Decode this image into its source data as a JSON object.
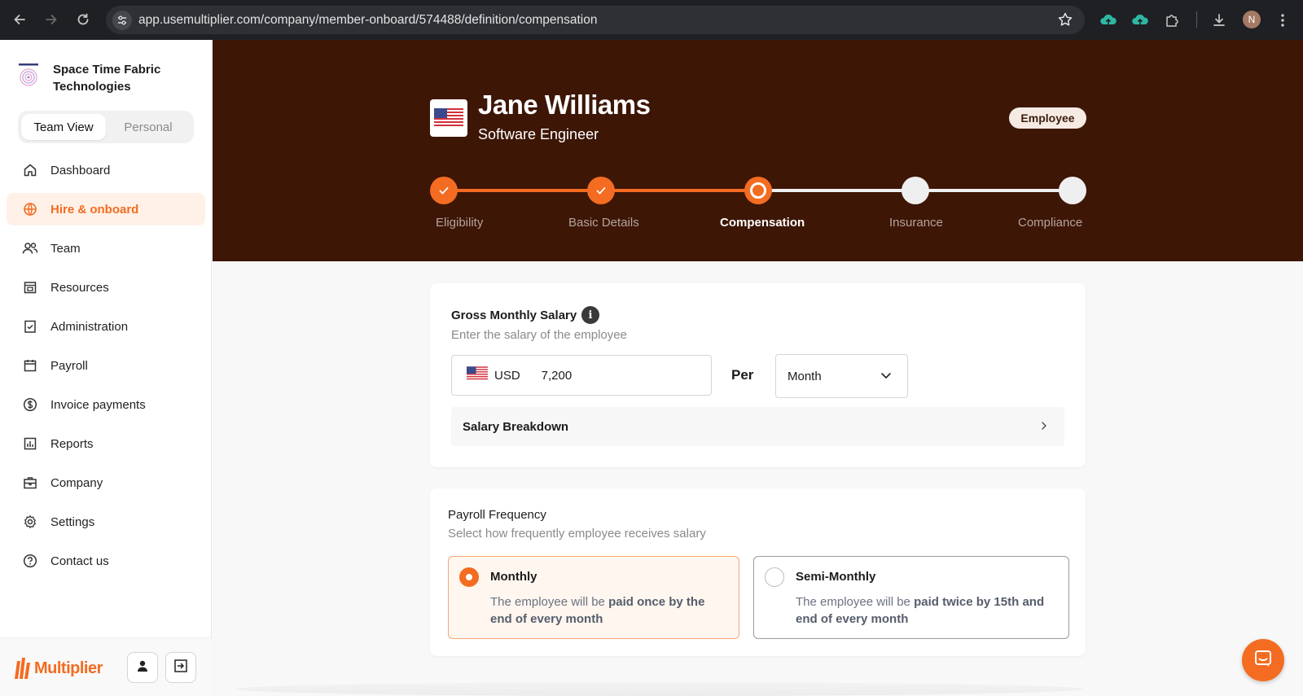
{
  "browser": {
    "url": "app.usemultiplier.com/company/member-onboard/574488/definition/compensation",
    "profile_initial": "N"
  },
  "sidebar": {
    "company_name": "Space Time Fabric Technologies",
    "view_toggle": {
      "active": "Team View",
      "inactive": "Personal"
    },
    "items": [
      {
        "label": "Dashboard",
        "icon": "home-icon"
      },
      {
        "label": "Hire & onboard",
        "icon": "globe-icon",
        "active": true
      },
      {
        "label": "Team",
        "icon": "people-icon"
      },
      {
        "label": "Resources",
        "icon": "calendar-grid-icon"
      },
      {
        "label": "Administration",
        "icon": "clipboard-check-icon"
      },
      {
        "label": "Payroll",
        "icon": "calendar-icon"
      },
      {
        "label": "Invoice payments",
        "icon": "dollar-circle-icon"
      },
      {
        "label": "Reports",
        "icon": "chart-icon"
      },
      {
        "label": "Company",
        "icon": "briefcase-icon"
      },
      {
        "label": "Settings",
        "icon": "gear-icon"
      },
      {
        "label": "Contact us",
        "icon": "help-icon"
      }
    ],
    "brand": "Multiplier"
  },
  "header": {
    "name": "Jane Williams",
    "role": "Software Engineer",
    "badge": "Employee",
    "steps": [
      {
        "label": "Eligibility",
        "state": "done"
      },
      {
        "label": "Basic Details",
        "state": "done"
      },
      {
        "label": "Compensation",
        "state": "current"
      },
      {
        "label": "Insurance",
        "state": "todo"
      },
      {
        "label": "Compliance",
        "state": "todo"
      }
    ]
  },
  "salary": {
    "title": "Gross Monthly Salary",
    "info_icon": "i",
    "subtitle": "Enter the salary of the employee",
    "currency": "USD",
    "amount": "7,200",
    "per_label": "Per",
    "period": "Month",
    "breakdown_label": "Salary Breakdown"
  },
  "payroll": {
    "title": "Payroll Frequency",
    "subtitle": "Select how frequently employee receives salary",
    "options": [
      {
        "title": "Monthly",
        "desc_prefix": "The employee will be ",
        "desc_bold": "paid once by the end of every month",
        "selected": true
      },
      {
        "title": "Semi-Monthly",
        "desc_prefix": "The employee will be ",
        "desc_bold": "paid twice by 15th and end of every month",
        "selected": false
      }
    ]
  },
  "colors": {
    "accent": "#f36c21",
    "header_bg": "#3d1606",
    "sidebar_active_bg": "#fff1e8"
  }
}
